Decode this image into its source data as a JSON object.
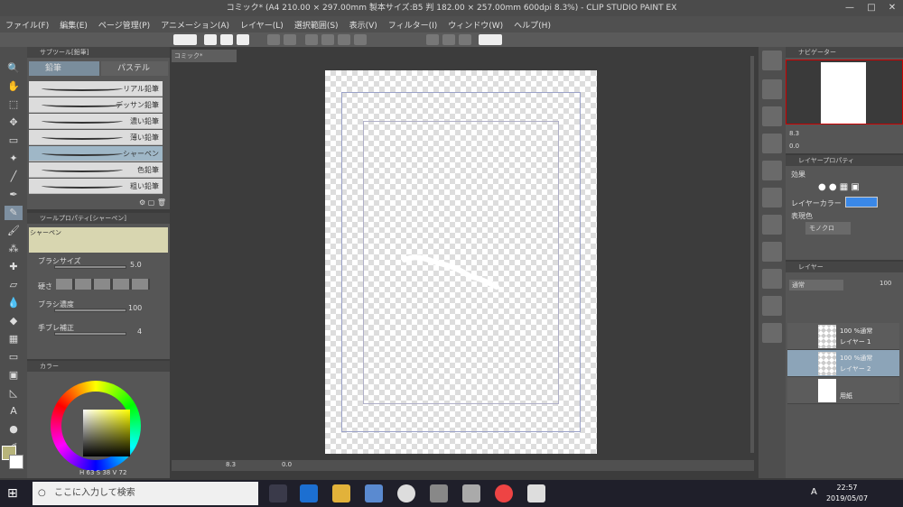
{
  "window": {
    "title": "コミック* (A4 210.00 × 297.00mm 製本サイズ:B5 判 182.00 × 257.00mm 600dpi 8.3%) - CLIP STUDIO PAINT EX"
  },
  "menu": [
    "ファイル(F)",
    "編集(E)",
    "ページ管理(P)",
    "アニメーション(A)",
    "レイヤー(L)",
    "選択範囲(S)",
    "表示(V)",
    "フィルター(I)",
    "ウィンドウ(W)",
    "ヘルプ(H)"
  ],
  "subtool": {
    "header": "サブツール[鉛筆]",
    "tabs": [
      "鉛筆",
      "パステル"
    ],
    "brushes": [
      "リアル鉛筆",
      "デッサン鉛筆",
      "濃い鉛筆",
      "薄い鉛筆",
      "シャーペン",
      "色鉛筆",
      "粗い鉛筆"
    ],
    "selected": "シャーペン"
  },
  "toolprop": {
    "header": "ツールプロパティ[シャーペン]",
    "preview_name": "シャーペン",
    "brush_size_label": "ブラシサイズ",
    "brush_size": "5.0",
    "hardness_label": "硬さ",
    "density_label": "ブラシ濃度",
    "density": "100",
    "stabilizer_label": "手ブレ補正",
    "stabilizer": "4"
  },
  "color": {
    "header": "カラー",
    "h": "63",
    "s": "38",
    "v": "72"
  },
  "canvas": {
    "tab": "コミック*",
    "zoom": "8.3",
    "angle": "0.0"
  },
  "navigator": {
    "header": "ナビゲーター",
    "zoom": "8.3",
    "angle": "0.0"
  },
  "layerprop": {
    "header": "レイヤープロパティ",
    "effect_label": "効果",
    "layer_color_label": "レイヤーカラー",
    "expression_label": "表現色",
    "expression_value": "モノクロ"
  },
  "layers": {
    "tab": "レイヤー",
    "blend_mode": "通常",
    "opacity": "100",
    "rows": [
      {
        "line1": "100 %通常",
        "line2": "レイヤー 1"
      },
      {
        "line1": "100 %通常",
        "line2": "レイヤー 2"
      },
      {
        "line1": "",
        "line2": "用紙"
      }
    ]
  },
  "taskbar": {
    "search_placeholder": "ここに入力して検索",
    "time": "22:57",
    "date": "2019/05/07",
    "ime": "A"
  }
}
